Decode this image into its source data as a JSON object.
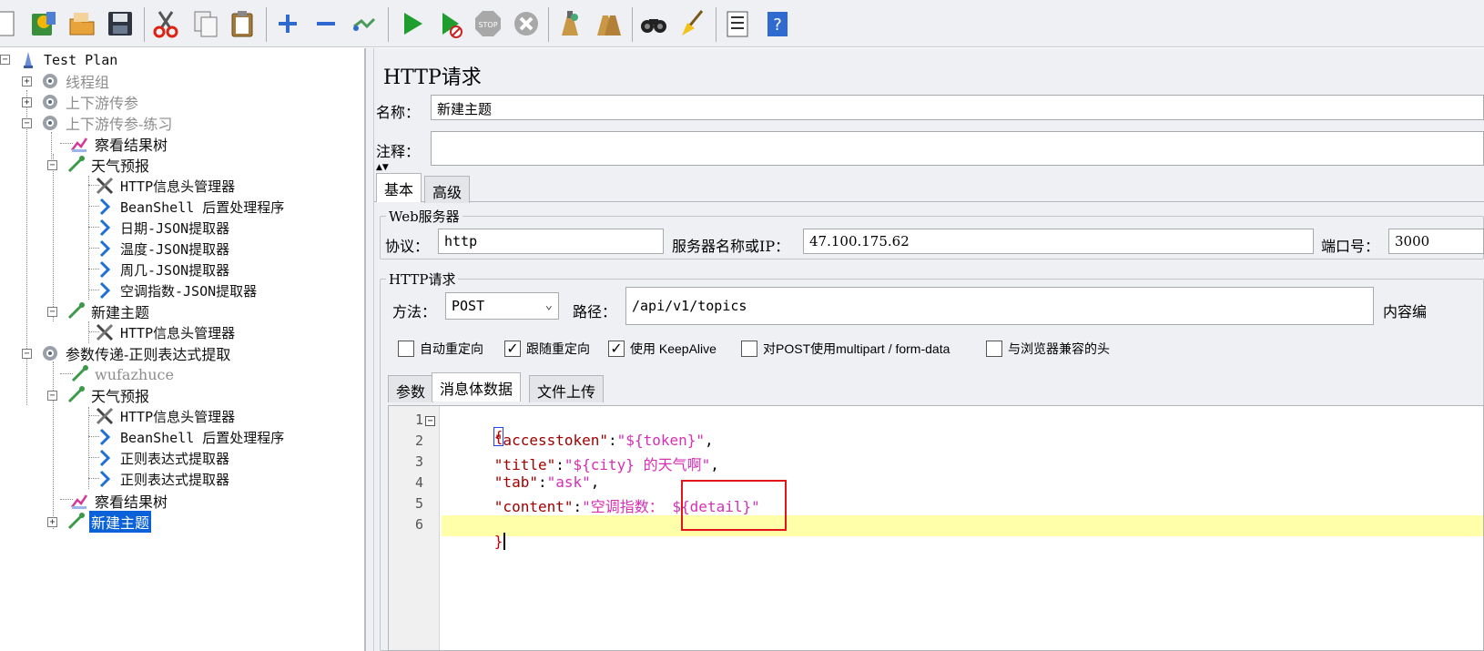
{
  "toolbar": {
    "buttons": [
      "new-icon",
      "templates-icon",
      "open-icon",
      "save-icon",
      "cut-icon",
      "copy-icon",
      "paste-icon",
      "expand-icon",
      "collapse-icon",
      "toggle-icon",
      "start-icon",
      "start-no-pause-icon",
      "stop-icon",
      "shutdown-icon",
      "clear-icon",
      "clear-all-icon",
      "search-icon",
      "reset-search-icon",
      "function-helper-icon",
      "help-icon"
    ]
  },
  "tree": {
    "root": "Test Plan",
    "n1": "线程组",
    "n2": "上下游传参",
    "n3": "上下游传参-练习",
    "n3_1": "察看结果树",
    "n3_2": "天气预报",
    "n3_2_1": "HTTP信息头管理器",
    "n3_2_2": "BeanShell 后置处理程序",
    "n3_2_3": "日期-JSON提取器",
    "n3_2_4": "温度-JSON提取器",
    "n3_2_5": "周几-JSON提取器",
    "n3_2_6": "空调指数-JSON提取器",
    "n3_3": "新建主题",
    "n3_3_1": "HTTP信息头管理器",
    "n4": "参数传递-正则表达式提取",
    "n4_1": "wufazhuce",
    "n4_2": "天气预报",
    "n4_2_1": "HTTP信息头管理器",
    "n4_2_2": "BeanShell 后置处理程序",
    "n4_2_3": "正则表达式提取器",
    "n4_2_4": "正则表达式提取器",
    "n4_3": "察看结果树",
    "n4_4": "新建主题"
  },
  "panel": {
    "title": "HTTP请求",
    "name_label": "名称：",
    "name_value": "新建主题",
    "comment_label": "注释：",
    "comment_value": "",
    "tab_basic": "基本",
    "tab_advanced": "高级",
    "web_server_group": "Web服务器",
    "protocol_label": "协议：",
    "protocol_value": "http",
    "server_label": "服务器名称或IP：",
    "server_value": "47.100.175.62",
    "port_label": "端口号：",
    "port_value": "3000",
    "http_request_group": "HTTP请求",
    "method_label": "方法：",
    "method_value": "POST",
    "path_label": "路径：",
    "path_value": "/api/v1/topics",
    "content_encoding_label": "内容编",
    "checkboxes": [
      {
        "label": "自动重定向",
        "checked": false
      },
      {
        "label": "跟随重定向",
        "checked": true
      },
      {
        "label": "使用 KeepAlive",
        "checked": true
      },
      {
        "label": "对POST使用multipart / form-data",
        "checked": false
      },
      {
        "label": "与浏览器兼容的头",
        "checked": false
      }
    ],
    "subtab_params": "参数",
    "subtab_body": "消息体数据",
    "subtab_files": "文件上传"
  },
  "editor": {
    "line_numbers": [
      "1",
      "2",
      "3",
      "4",
      "5",
      "6"
    ],
    "l1_brace": "{",
    "l2_key": "\"accesstoken\"",
    "l2_colon": ":",
    "l2_val": "\"${token}\"",
    "l2_comma": ",",
    "l3_key": "\"title\"",
    "l3_colon": ":",
    "l3_val": "\"${city} 的天气啊\"",
    "l3_comma": ",",
    "l4_key": "\"tab\"",
    "l4_colon": ":",
    "l4_val": "\"ask\"",
    "l4_comma": ",",
    "l5_key": "\"content\"",
    "l5_colon": ":",
    "l5_val": "\"空调指数： ${detail}\"",
    "l6_brace": "}"
  },
  "colors": {
    "selection": "#0b61d8",
    "string": "#d62fb5",
    "key": "#a00000",
    "highlight_line": "#ffffaa",
    "annotation": "#e3151b"
  }
}
